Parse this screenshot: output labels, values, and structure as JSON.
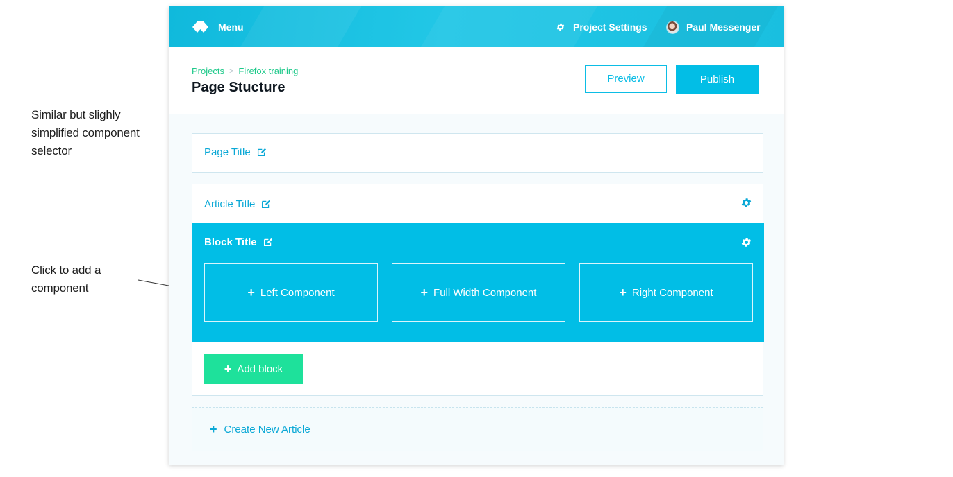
{
  "annotations": {
    "note_1": "Similar but slighly simplified component selector",
    "note_2": "Click to add a component"
  },
  "topbar": {
    "menu_label": "Menu",
    "settings_label": "Project Settings",
    "user_name": "Paul Messenger",
    "color": "#1bc3e4"
  },
  "header": {
    "breadcrumb": [
      "Projects",
      "Firefox training"
    ],
    "breadcrumb_separator": ">",
    "title": "Page Stucture",
    "preview_label": "Preview",
    "publish_label": "Publish"
  },
  "page_title_card": {
    "label": "Page Title"
  },
  "article": {
    "label": "Article Title",
    "block": {
      "label": "Block Title",
      "components": [
        "Left Component",
        "Full Width Component",
        "Right Component"
      ]
    },
    "add_block_label": "Add block"
  },
  "create_article_label": "Create New Article",
  "icons": {
    "menu": "logo-diamond-icon",
    "settings": "gear-icon",
    "edit": "edit-icon",
    "add": "plus-icon"
  },
  "colors": {
    "accent": "#02bee6",
    "green": "#1ee19b",
    "breadcrumb": "#1ec98a"
  }
}
